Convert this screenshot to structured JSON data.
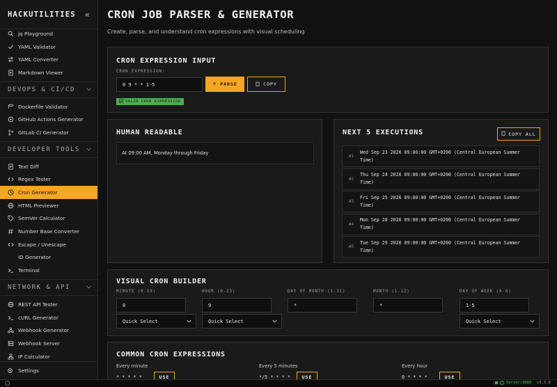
{
  "sidebar": {
    "brand": "HACKUTILITIES",
    "collapse_glyph": "«",
    "items_top": [
      {
        "label": "jq Playground",
        "icon": "search-icon"
      },
      {
        "label": "YAML Validator",
        "icon": "check-icon"
      },
      {
        "label": "YAML Converter",
        "icon": "convert-icon"
      },
      {
        "label": "Markdown Viewer",
        "icon": "document-icon"
      }
    ],
    "sections": [
      {
        "title": "DEVOPS & CI/CD",
        "items": [
          {
            "label": "Dockerfile Validator",
            "icon": "database-icon"
          },
          {
            "label": "GitHub Actions Generator",
            "icon": "play-icon"
          },
          {
            "label": "GitLab CI Generator",
            "icon": "git-branch-icon"
          }
        ]
      },
      {
        "title": "DEVELOPER TOOLS",
        "items": [
          {
            "label": "Text Diff",
            "icon": "document-icon"
          },
          {
            "label": "Regex Tester",
            "icon": "code-icon"
          },
          {
            "label": "Cron Generator",
            "icon": "clock-icon",
            "active": true
          },
          {
            "label": "HTML Previewer",
            "icon": "globe-icon"
          },
          {
            "label": "SemVer Calculator",
            "icon": "tag-icon"
          },
          {
            "label": "Number Base Converter",
            "icon": "hash-icon"
          },
          {
            "label": "Escape / Unescape",
            "icon": "code-icon"
          },
          {
            "label": "ID Generator",
            "icon": "fingerprint-icon"
          },
          {
            "label": "Terminal",
            "icon": "terminal-icon"
          }
        ]
      },
      {
        "title": "NETWORK & API",
        "items": [
          {
            "label": "REST API Tester",
            "icon": "globe-icon"
          },
          {
            "label": "cURL Generator",
            "icon": "terminal-icon"
          },
          {
            "label": "Webhook Generator",
            "icon": "webhook-icon"
          },
          {
            "label": "Webhook Server",
            "icon": "server-icon"
          },
          {
            "label": "IP Calculator",
            "icon": "network-icon"
          }
        ]
      }
    ],
    "settings_label": "Settings"
  },
  "page": {
    "title": "CRON JOB PARSER & GENERATOR",
    "subtitle": "Create, parse, and understand cron expressions with visual scheduling"
  },
  "input_card": {
    "title": "CRON EXPRESSION INPUT",
    "field_label": "CRON EXPRESSION:",
    "expression": "0 9 * * 1-5",
    "parse_label": "PARSE",
    "copy_label": "COPY",
    "badge": "VALID CRON EXPRESSION"
  },
  "human_card": {
    "title": "HUMAN READABLE",
    "text": "At 09:00 AM, Monday through Friday"
  },
  "exec_card": {
    "title": "NEXT 5 EXECUTIONS",
    "copy_all_label": "COPY ALL",
    "rows": [
      {
        "idx": "#1",
        "line1": "Wed Sep 23 2026 09:00:00 GMT+0200 (Central European Summer",
        "line2": "Time)"
      },
      {
        "idx": "#2",
        "line1": "Thu Sep 24 2026 09:00:00 GMT+0200 (Central European Summer",
        "line2": "Time)"
      },
      {
        "idx": "#3",
        "line1": "Fri Sep 25 2026 09:00:00 GMT+0200 (Central European Summer",
        "line2": "Time)"
      },
      {
        "idx": "#4",
        "line1": "Mon Sep 28 2026 09:00:00 GMT+0200 (Central European Summer",
        "line2": "Time)"
      },
      {
        "idx": "#5",
        "line1": "Tue Sep 29 2026 09:00:00 GMT+0200 (Central European Summer",
        "line2": "Time)"
      }
    ]
  },
  "builder_card": {
    "title": "VISUAL CRON BUILDER",
    "fields": [
      {
        "label": "MINUTE (0-59)",
        "value": "0",
        "quick_select": "Quick Select"
      },
      {
        "label": "HOUR (0-23)",
        "value": "9",
        "quick_select": "Quick Select"
      },
      {
        "label": "DAY OF MONTH (1-31)",
        "value": "*"
      },
      {
        "label": "MONTH (1-12)",
        "value": "*"
      },
      {
        "label": "DAY OF WEEK (0-6)",
        "value": "1-5",
        "quick_select": "Quick Select"
      }
    ]
  },
  "common_card": {
    "title": "COMMON CRON EXPRESSIONS",
    "items": [
      {
        "label": "Every minute",
        "expr": "* * * * *",
        "use_label": "USE"
      },
      {
        "label": "Every 5 minutes",
        "expr": "*/5 * * * *",
        "use_label": "USE"
      },
      {
        "label": "Every hour",
        "expr": "0 * * * *",
        "use_label": "USE"
      }
    ]
  },
  "footer": {
    "server": "Server:9080",
    "version": "v3.5.0"
  },
  "colors": {
    "accent": "#f5a623",
    "success": "#4caf50"
  }
}
